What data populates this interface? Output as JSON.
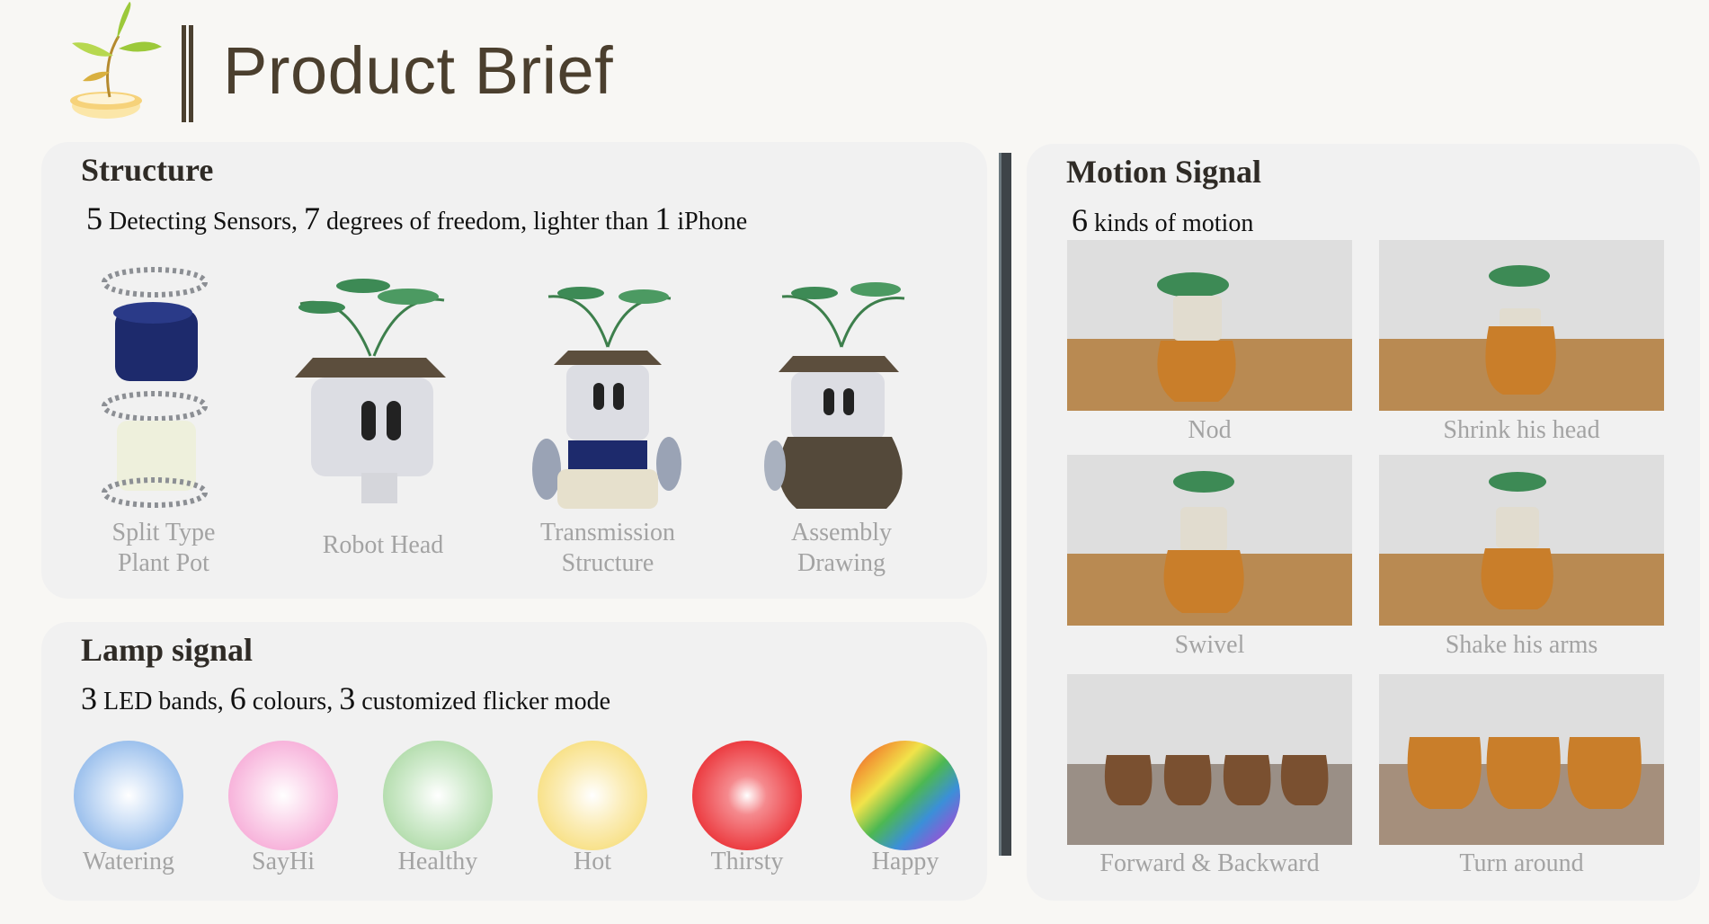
{
  "header": {
    "title": "Product Brief",
    "logo_icon": "plant-sprout-logo"
  },
  "structure": {
    "title": "Structure",
    "stat": {
      "n1": "5",
      "t1": " Detecting Sensors, ",
      "n2": "7",
      "t2": " degrees of freedom, lighter than ",
      "n3": "1",
      "t3": " iPhone"
    },
    "items": [
      {
        "line1": "Split Type",
        "line2": "Plant Pot"
      },
      {
        "line1": "Robot Head"
      },
      {
        "line1": "Transmission",
        "line2": "Structure"
      },
      {
        "line1": "Assembly",
        "line2": "Drawing"
      }
    ]
  },
  "lamp": {
    "title": "Lamp signal",
    "stat": {
      "n1": "3",
      "t1": " LED bands, ",
      "n2": "6",
      "t2": " colours, ",
      "n3": "3",
      "t3": " customized flicker mode"
    },
    "leds": [
      {
        "label": "Watering",
        "color": "#8fb8ea"
      },
      {
        "label": "SayHi",
        "color": "#f6a9d6"
      },
      {
        "label": "Healthy",
        "color": "#a8d7a0"
      },
      {
        "label": "Hot",
        "color": "#f7dc74"
      },
      {
        "label": "Thirsty",
        "color": "#ec3d42"
      },
      {
        "label": "Happy",
        "color": "rainbow"
      }
    ]
  },
  "motion": {
    "title": "Motion Signal",
    "stat": {
      "n1": "6",
      "t1": " kinds of motion"
    },
    "items": [
      {
        "label": "Nod"
      },
      {
        "label": "Shrink his head"
      },
      {
        "label": "Swivel"
      },
      {
        "label": "Shake his arms"
      },
      {
        "label": "Forward & Backward"
      },
      {
        "label": "Turn around"
      }
    ]
  }
}
